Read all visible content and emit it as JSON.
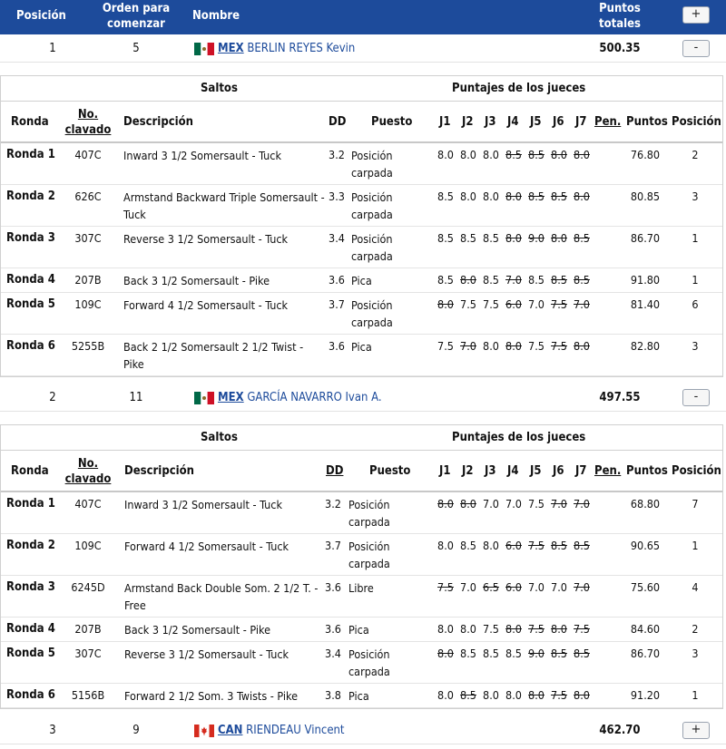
{
  "header": {
    "posicion": "Posición",
    "orden": "Orden para comenzar",
    "nombre": "Nombre",
    "puntos": "Puntos totales",
    "toggle": "+"
  },
  "detail_headers": {
    "saltos": "Saltos",
    "puntajes": "Puntajes de los jueces",
    "ronda": "Ronda",
    "no_clavado": "No. clavado",
    "descripcion": "Descripción",
    "dd": "DD",
    "puesto": "Puesto",
    "j1": "J1",
    "j2": "J2",
    "j3": "J3",
    "j4": "J4",
    "j5": "J5",
    "j6": "J6",
    "j7": "J7",
    "pen": "Pen.",
    "puntos": "Puntos",
    "posicion": "Posición"
  },
  "colors": {
    "header_bg": "#1d4b9b",
    "link": "#1d4b9b"
  },
  "athletes": [
    {
      "position": "1",
      "order": "5",
      "noc": "MEX",
      "name": "BERLIN REYES Kevin",
      "points": "500.35",
      "toggle": "-",
      "flag": "mexico-flag-icon",
      "dives": [
        {
          "ronda": "Ronda 1",
          "no": "407C",
          "desc": "Inward 3 1/2 Somersault - Tuck",
          "dd": "3.2",
          "puesto": "Posición carpada",
          "scores": [
            "8.0",
            "8.0",
            "8.0",
            "8.5",
            "8.5",
            "8.0",
            "8.0"
          ],
          "struck": [
            3,
            4,
            5,
            6
          ],
          "pts": "76.80",
          "pos": "2"
        },
        {
          "ronda": "Ronda 2",
          "no": "626C",
          "desc": "Armstand Backward Triple Somersault - Tuck",
          "dd": "3.3",
          "puesto": "Posición carpada",
          "scores": [
            "8.5",
            "8.0",
            "8.0",
            "8.0",
            "8.5",
            "8.5",
            "8.0"
          ],
          "struck": [
            3,
            4,
            5,
            6
          ],
          "pts": "80.85",
          "pos": "3"
        },
        {
          "ronda": "Ronda 3",
          "no": "307C",
          "desc": "Reverse 3 1/2 Somersault - Tuck",
          "dd": "3.4",
          "puesto": "Posición carpada",
          "scores": [
            "8.5",
            "8.5",
            "8.5",
            "8.0",
            "9.0",
            "8.0",
            "8.5"
          ],
          "struck": [
            3,
            4,
            5,
            6
          ],
          "pts": "86.70",
          "pos": "1"
        },
        {
          "ronda": "Ronda 4",
          "no": "207B",
          "desc": "Back 3 1/2 Somersault - Pike",
          "dd": "3.6",
          "puesto": "Pica",
          "scores": [
            "8.5",
            "8.0",
            "8.5",
            "7.0",
            "8.5",
            "8.5",
            "8.5"
          ],
          "struck": [
            1,
            3,
            5,
            6
          ],
          "pts": "91.80",
          "pos": "1"
        },
        {
          "ronda": "Ronda 5",
          "no": "109C",
          "desc": "Forward 4 1/2 Somersault - Tuck",
          "dd": "3.7",
          "puesto": "Posición carpada",
          "scores": [
            "8.0",
            "7.5",
            "7.5",
            "6.0",
            "7.0",
            "7.5",
            "7.0"
          ],
          "struck": [
            0,
            3,
            5,
            6
          ],
          "pts": "81.40",
          "pos": "6"
        },
        {
          "ronda": "Ronda 6",
          "no": "5255B",
          "desc": "Back 2 1/2 Somersault 2 1/2 Twist - Pike",
          "dd": "3.6",
          "puesto": "Pica",
          "scores": [
            "7.5",
            "7.0",
            "8.0",
            "8.0",
            "7.5",
            "7.5",
            "8.0"
          ],
          "struck": [
            1,
            3,
            5,
            6
          ],
          "pts": "82.80",
          "pos": "3"
        }
      ]
    },
    {
      "position": "2",
      "order": "11",
      "noc": "MEX",
      "name": "GARCÍA NAVARRO Ivan A.",
      "points": "497.55",
      "toggle": "-",
      "flag": "mexico-flag-icon",
      "dives": [
        {
          "ronda": "Ronda 1",
          "no": "407C",
          "desc": "Inward 3 1/2 Somersault - Tuck",
          "dd": "3.2",
          "puesto": "Posición carpada",
          "scores": [
            "8.0",
            "8.0",
            "7.0",
            "7.0",
            "7.5",
            "7.0",
            "7.0"
          ],
          "struck": [
            0,
            1,
            5,
            6
          ],
          "pts": "68.80",
          "pos": "7"
        },
        {
          "ronda": "Ronda 2",
          "no": "109C",
          "desc": "Forward 4 1/2 Somersault - Tuck",
          "dd": "3.7",
          "puesto": "Posición carpada",
          "scores": [
            "8.0",
            "8.5",
            "8.0",
            "6.0",
            "7.5",
            "8.5",
            "8.5"
          ],
          "struck": [
            3,
            4,
            5,
            6
          ],
          "pts": "90.65",
          "pos": "1"
        },
        {
          "ronda": "Ronda 3",
          "no": "6245D",
          "desc": "Armstand Back Double Som. 2 1/2 T. - Free",
          "dd": "3.6",
          "puesto": "Libre",
          "scores": [
            "7.5",
            "7.0",
            "6.5",
            "6.0",
            "7.0",
            "7.0",
            "7.0"
          ],
          "struck": [
            0,
            2,
            3,
            6
          ],
          "pts": "75.60",
          "pos": "4"
        },
        {
          "ronda": "Ronda 4",
          "no": "207B",
          "desc": "Back 3 1/2 Somersault - Pike",
          "dd": "3.6",
          "puesto": "Pica",
          "scores": [
            "8.0",
            "8.0",
            "7.5",
            "8.0",
            "7.5",
            "8.0",
            "7.5"
          ],
          "struck": [
            3,
            4,
            5,
            6
          ],
          "pts": "84.60",
          "pos": "2"
        },
        {
          "ronda": "Ronda 5",
          "no": "307C",
          "desc": "Reverse 3 1/2 Somersault - Tuck",
          "dd": "3.4",
          "puesto": "Posición carpada",
          "scores": [
            "8.0",
            "8.5",
            "8.5",
            "8.5",
            "9.0",
            "8.5",
            "8.5"
          ],
          "struck": [
            0,
            4,
            5,
            6
          ],
          "pts": "86.70",
          "pos": "3"
        },
        {
          "ronda": "Ronda 6",
          "no": "5156B",
          "desc": "Forward 2 1/2 Som. 3 Twists - Pike",
          "dd": "3.8",
          "puesto": "Pica",
          "scores": [
            "8.0",
            "8.5",
            "8.0",
            "8.0",
            "8.0",
            "7.5",
            "8.0"
          ],
          "struck": [
            1,
            4,
            5,
            6
          ],
          "pts": "91.20",
          "pos": "1"
        }
      ]
    },
    {
      "position": "3",
      "order": "9",
      "noc": "CAN",
      "name": "RIENDEAU Vincent",
      "points": "462.70",
      "toggle": "+",
      "flag": "canada-flag-icon",
      "dives": []
    }
  ]
}
